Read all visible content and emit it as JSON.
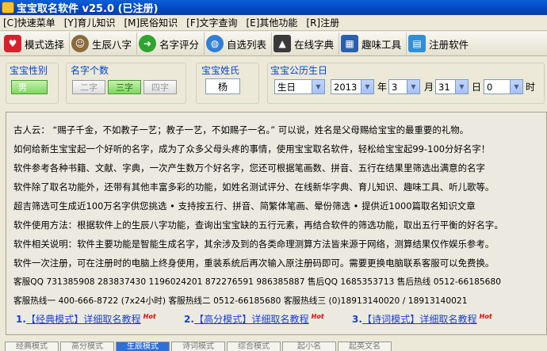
{
  "window": {
    "title": "宝宝取名软件 v25.0 (已注册)"
  },
  "menu": [
    "[C]快速菜单",
    "[Y]育儿知识",
    "[M]民俗知识",
    "[F]文字查询",
    "[E]其他功能",
    "[R]注册"
  ],
  "toolbar": [
    {
      "label": "模式选择",
      "icon": "heart-icon",
      "color": "#d8202a"
    },
    {
      "label": "生辰八字",
      "icon": "people-icon",
      "color": "#6b4d2a"
    },
    {
      "label": "名字评分",
      "icon": "arrow-right-icon",
      "color": "#2fa52f"
    },
    {
      "label": "自选列表",
      "icon": "globe-icon",
      "color": "#2f7fd8"
    },
    {
      "label": "在线字典",
      "icon": "scholar-icon",
      "color": "#3a3a3a"
    },
    {
      "label": "趣味工具",
      "icon": "grid-icon",
      "color": "#2a5fb0"
    },
    {
      "label": "注册软件",
      "icon": "document-icon",
      "color": "#2f8fd8"
    }
  ],
  "form": {
    "gender_label": "宝宝性别",
    "gender_value": "男",
    "name_len_label": "名字个数",
    "name_len_options": [
      "二字",
      "三字",
      "四字"
    ],
    "name_len_selected": "三字",
    "surname_label": "宝宝姓氏",
    "surname_value": "杨",
    "birth_label": "宝宝公历生日",
    "birth_type": "生日",
    "year": "2013",
    "year_unit": "年",
    "month": "3",
    "month_unit": "月",
    "day": "31",
    "day_unit": "日",
    "hour": "0",
    "hour_unit": "时"
  },
  "info": {
    "lines": [
      "古人云： “赐子千金，不如教子一艺；教子一艺，不如赐子一名。” 可以说，姓名是父母赐给宝宝的最重要的礼物。",
      "如何给新生宝宝起一个好听的名字，成为了众多父母头疼的事情，使用宝宝取名软件，轻松给宝宝起99-100分好名字！",
      "软件参考各种书籍、文献、字典，一次产生数万个好名字，您还可根据笔画数、拼音、五行在结果里筛选出满意的名字",
      "软件除了取名功能外，还带有其他丰富多彩的功能，如姓名测试评分、在线新华字典、育儿知识、趣味工具、听儿歌等。",
      "超吉筛选可生成近100万名字供您挑选   • 支持按五行、拼音、简繁体笔画、晕份筛选   • 提供近1000篇取名知识文章",
      "软件使用方法：根据软件上的生辰八字功能，查询出宝宝缺的五行元素，再结合软件的筛选功能，取出五行平衡的好名字。",
      "软件相关说明：软件主要功能是智能生成名字，其余涉及到的各类命理测算方法皆来源于网络，测算结果仅作娱乐参考。",
      "软件一次注册，可在注册时的电脑上终身使用，重装系统后再次输入原注册码即可。需要更换电脑联系客服可以免费换。",
      "客服QQ  731385908    283837430    1196024201    872276591    986385887        售后QQ  1685353713       售后热线  0512-66185680",
      "客服热线一  400-666-8722 (7x24小时)    客服热线二  0512-66185680      客服热线三  (0)18913140020 / 18913140021"
    ],
    "links": [
      {
        "num": "1.",
        "text": "【经典模式】详细取名教程",
        "hot": "Hot"
      },
      {
        "num": "2.",
        "text": "【高分模式】详细取名教程",
        "hot": "Hot"
      },
      {
        "num": "3.",
        "text": "【诗词模式】详细取名教程",
        "hot": "Hot"
      }
    ]
  },
  "bottom_tabs": [
    "经典模式",
    "高分模式",
    "生辰模式",
    "诗词模式",
    "综合模式",
    "起小名",
    "起英文名"
  ],
  "bottom_tab_active": 2
}
